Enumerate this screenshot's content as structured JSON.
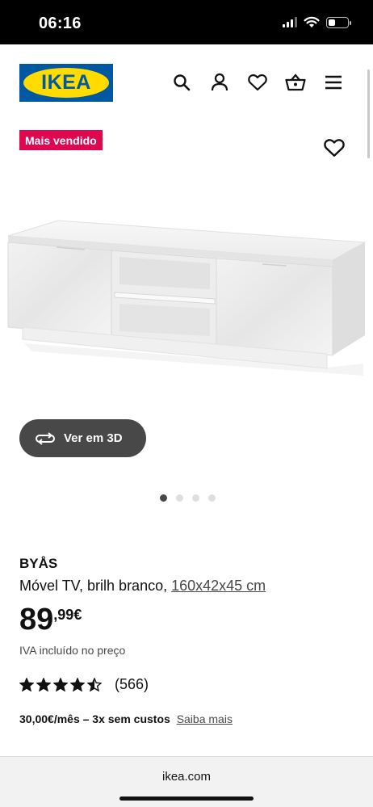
{
  "status_bar": {
    "time": "06:16",
    "battery_level": 0.35
  },
  "header": {
    "logo_text": "IKEA",
    "icons": [
      "search-icon",
      "account-icon",
      "favourites-icon",
      "shopping-basket-icon",
      "menu-icon"
    ]
  },
  "product": {
    "badge": "Mais vendido",
    "view_3d_label": "Ver em 3D",
    "image_count": 4,
    "active_image": 1,
    "name": "BYÅS",
    "description": "Móvel TV, brilh branco,",
    "dimensions": "160x42x45 cm",
    "price_integer": "89",
    "price_decimal": ",99",
    "currency": "€",
    "vat_note": "IVA incluído no preço",
    "rating_value": 4.5,
    "rating_count": "(566)",
    "installment_text": "30,00€/mês – 3x sem custos",
    "installment_link": "Saiba mais"
  },
  "browser": {
    "url": "ikea.com"
  },
  "colors": {
    "ikea_blue": "#0058a3",
    "ikea_yellow": "#ffdb00",
    "badge_red": "#e00751",
    "dark_button": "#484848"
  }
}
